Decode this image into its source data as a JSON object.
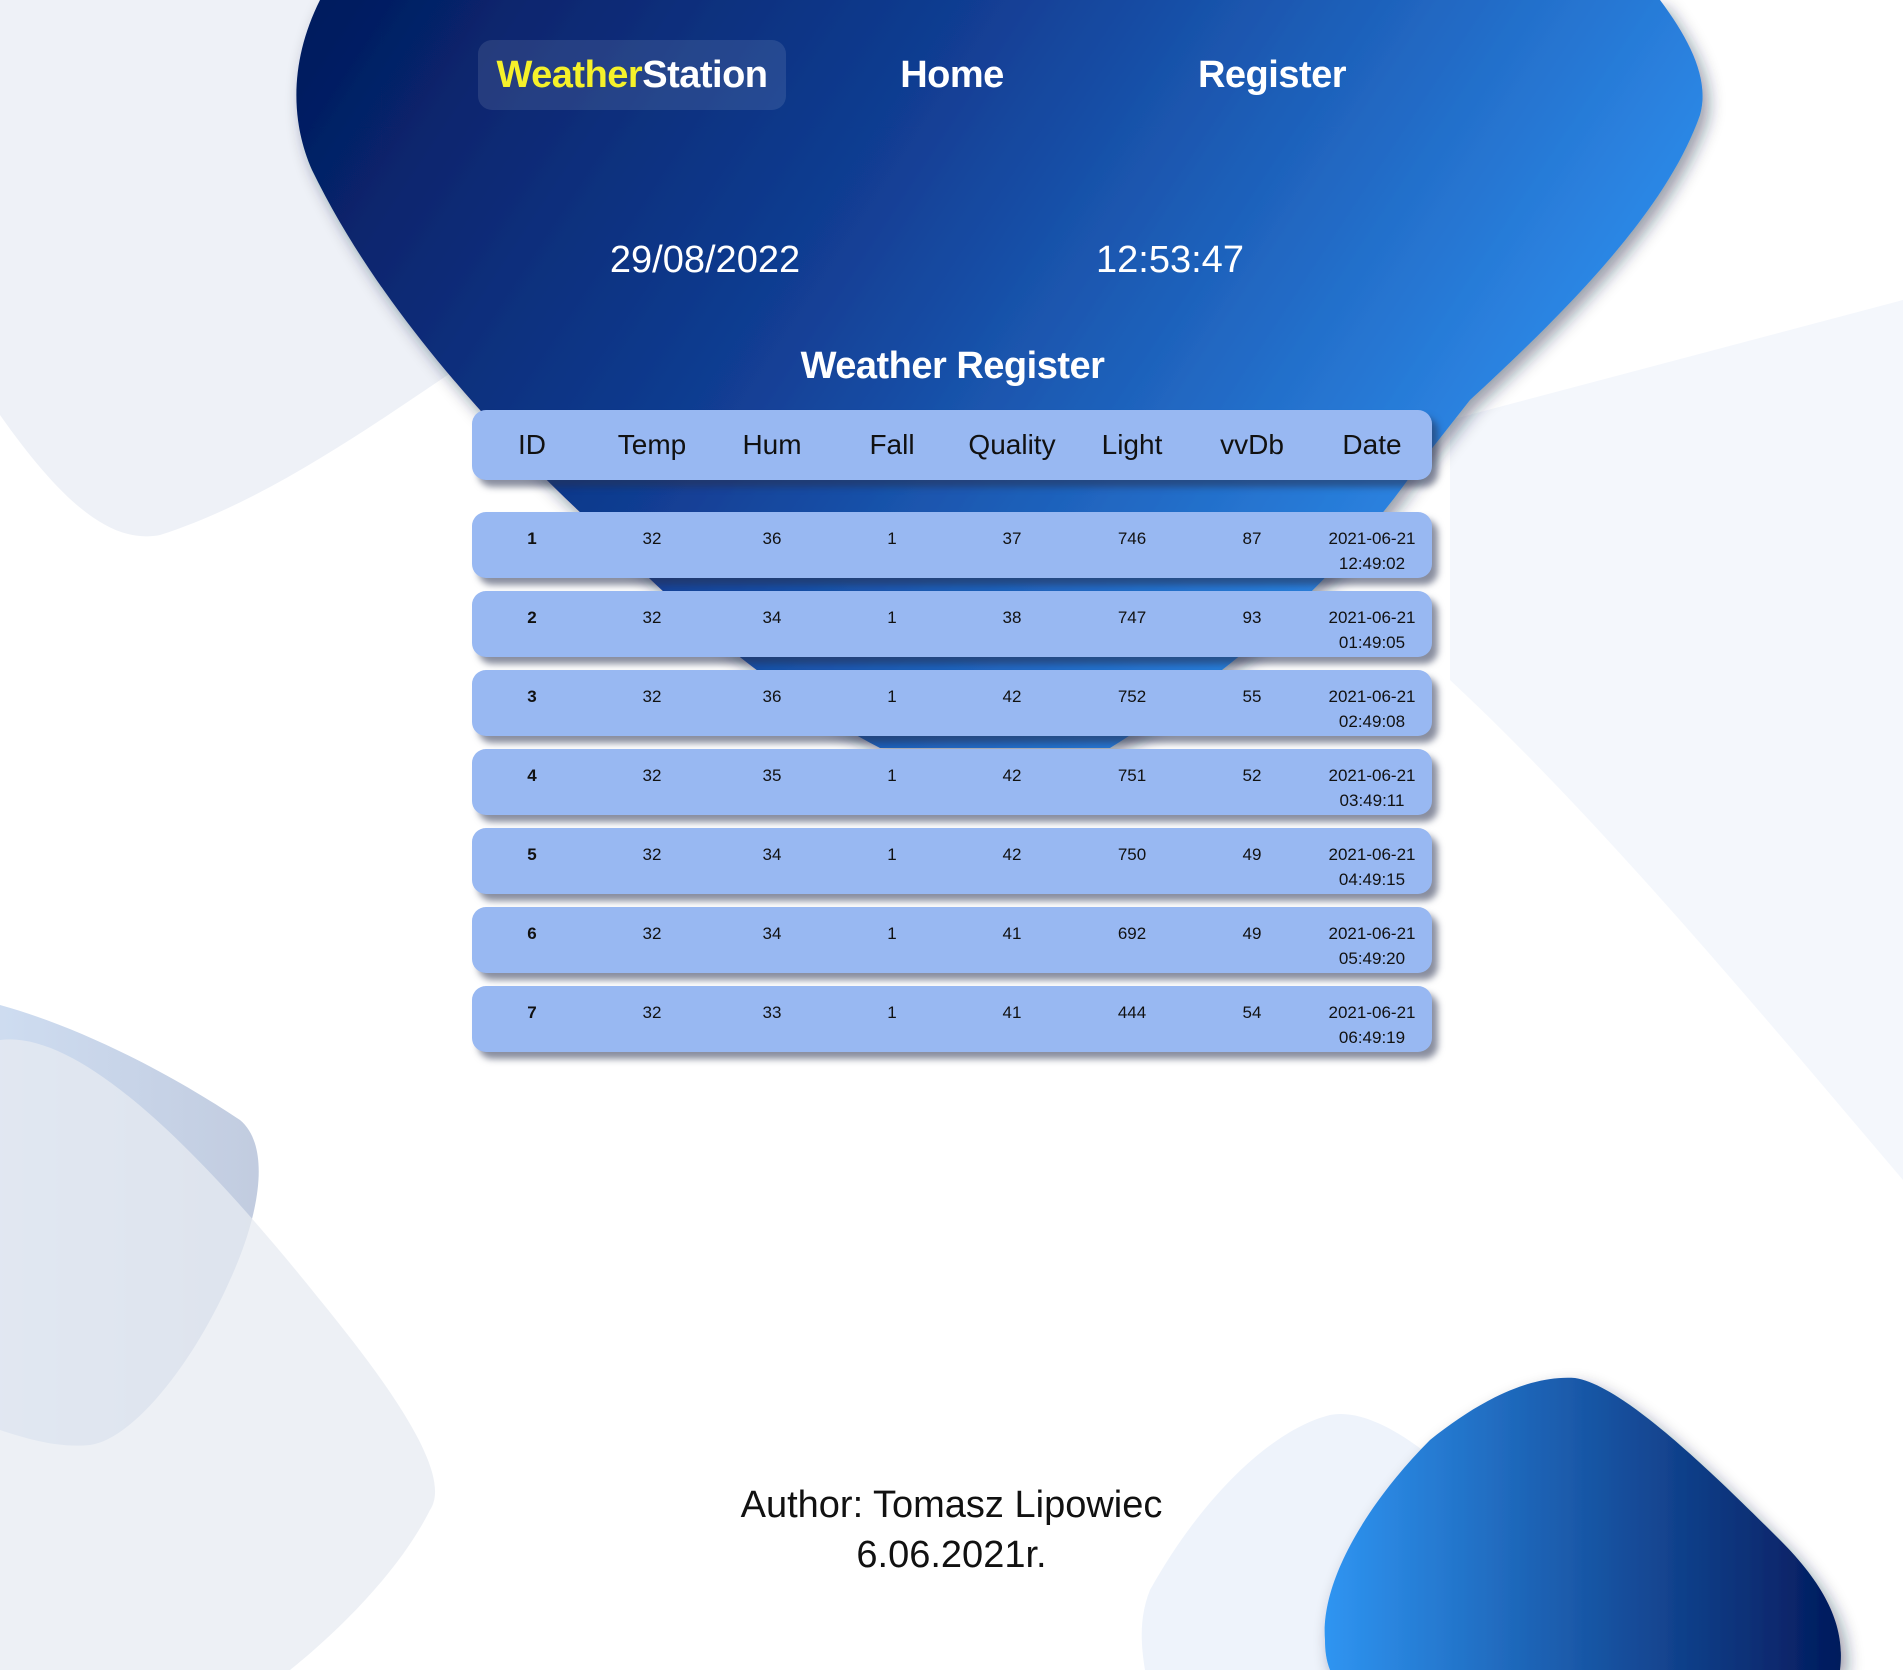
{
  "nav": {
    "brand_a": "Weather",
    "brand_b": "Station",
    "home": "Home",
    "register": "Register"
  },
  "clock": {
    "date": "29/08/2022",
    "time": "12:53:47"
  },
  "title": "Weather Register",
  "table": {
    "columns": [
      "ID",
      "Temp",
      "Hum",
      "Fall",
      "Quality",
      "Light",
      "vvDb",
      "Date"
    ],
    "rows": [
      [
        "1",
        "32",
        "36",
        "1",
        "37",
        "746",
        "87",
        "2021-06-21\n12:49:02"
      ],
      [
        "2",
        "32",
        "34",
        "1",
        "38",
        "747",
        "93",
        "2021-06-21\n01:49:05"
      ],
      [
        "3",
        "32",
        "36",
        "1",
        "42",
        "752",
        "55",
        "2021-06-21\n02:49:08"
      ],
      [
        "4",
        "32",
        "35",
        "1",
        "42",
        "751",
        "52",
        "2021-06-21\n03:49:11"
      ],
      [
        "5",
        "32",
        "34",
        "1",
        "42",
        "750",
        "49",
        "2021-06-21\n04:49:15"
      ],
      [
        "6",
        "32",
        "34",
        "1",
        "41",
        "692",
        "49",
        "2021-06-21\n05:49:20"
      ],
      [
        "7",
        "32",
        "33",
        "1",
        "41",
        "444",
        "54",
        "2021-06-21\n06:49:19"
      ]
    ]
  },
  "footer": {
    "author": "Author: Tomasz Lipowiec",
    "date": "6.06.2021r."
  },
  "colors": {
    "brand_highlight": "#f5f12a",
    "header_dark": "#031a5c",
    "header_light": "#2f8fee",
    "row_bg": "#98b8f2"
  }
}
